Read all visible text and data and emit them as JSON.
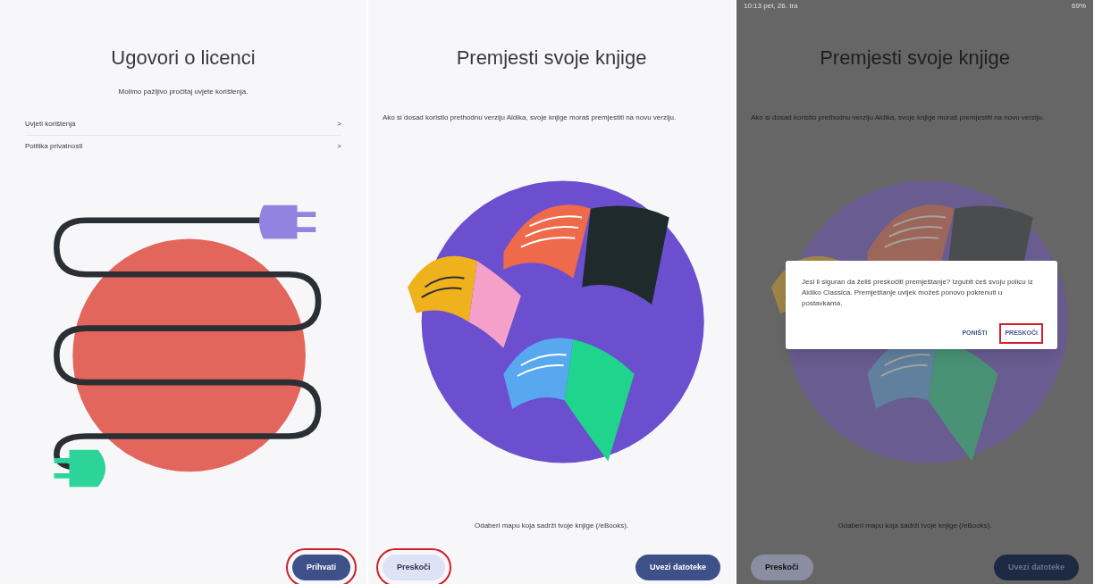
{
  "panels": [
    {
      "kind": "license",
      "dimmed": false,
      "title": "Ugovori o licenci",
      "subtitle": "Molimo pažljivo pročitaj uvjete korištenja.",
      "links": [
        {
          "label": "Uvjeti korištenja",
          "chevron": ">"
        },
        {
          "label": "Politika privatnosti",
          "chevron": ">"
        }
      ],
      "buttons": [
        {
          "label": "Prihvati",
          "kind": "filled",
          "highlighted": true
        }
      ]
    },
    {
      "kind": "move",
      "dimmed": false,
      "title": "Premjesti svoje knjige",
      "description": "Ako si dosad koristio prethodnu verziju Aldika, svoje knjige moraš premjestiti na novu verziju.",
      "prompt": "Odaberi mapu koja sadrži tvoje knjige (/eBooks).",
      "buttons": [
        {
          "label": "Preskoči",
          "kind": "tonal",
          "highlighted": true
        },
        {
          "label": "Uvezi datoteke",
          "kind": "filled",
          "highlighted": false
        }
      ]
    },
    {
      "kind": "move",
      "dimmed": true,
      "status_bar": {
        "time": "10:13",
        "date": "pet, 26. tra",
        "battery": "69%"
      },
      "title": "Premjesti svoje knjige",
      "description": "Ako si dosad koristio prethodnu verziju Aldika, svoje knjige moraš premjestiti na novu verziju.",
      "prompt": "Odaberi mapu koja sadrži tvoje knjige (/eBooks).",
      "buttons": [
        {
          "label": "Preskoči",
          "kind": "tonal",
          "highlighted": false
        },
        {
          "label": "Uvezi datoteke",
          "kind": "filled",
          "highlighted": false
        }
      ],
      "dialog": {
        "message": "Jesi li siguran da želiš preskočiti premještanje? Izgubit ćeš svoju policu iz Aldiko Classica. Premještanje uvijek možeš ponovo pokrenuti u postavkama.",
        "buttons": [
          {
            "label": "PONIŠTI",
            "highlighted": false
          },
          {
            "label": "PRESKOČI",
            "highlighted": true
          }
        ]
      }
    }
  ]
}
